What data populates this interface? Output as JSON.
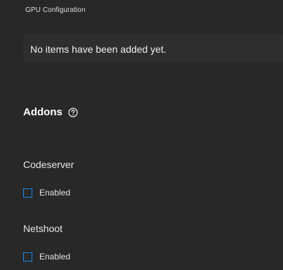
{
  "gpu": {
    "section_label": "GPU Configuration",
    "empty_message": "No items have been added yet."
  },
  "addons": {
    "title": "Addons",
    "help_icon": "help-circle-icon",
    "items": [
      {
        "title": "Codeserver",
        "checkbox_label": "Enabled",
        "checked": false
      },
      {
        "title": "Netshoot",
        "checkbox_label": "Enabled",
        "checked": false
      }
    ]
  },
  "colors": {
    "background": "#282828",
    "panel": "#2e2e2e",
    "accent": "#1e88e5",
    "text": "#e8e8e8"
  }
}
